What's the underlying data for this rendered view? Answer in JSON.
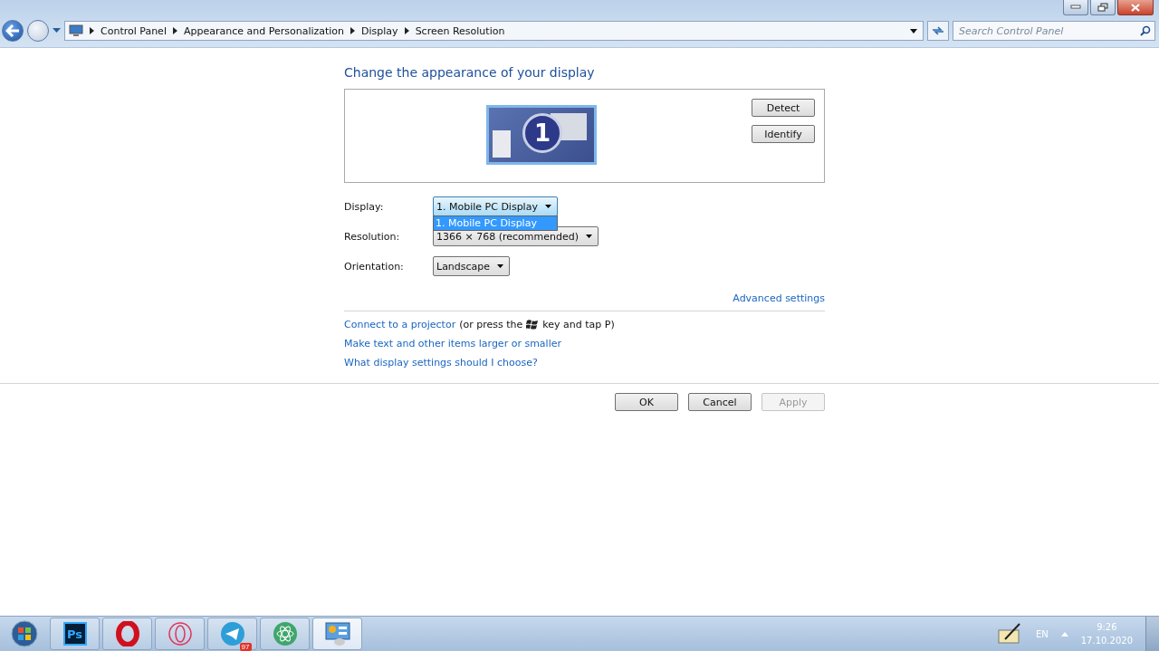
{
  "breadcrumb": [
    "Control Panel",
    "Appearance and Personalization",
    "Display",
    "Screen Resolution"
  ],
  "search": {
    "placeholder": "Search Control Panel"
  },
  "heading": "Change the appearance of your display",
  "monitor": {
    "number": "1"
  },
  "preview_buttons": [
    "Detect",
    "Identify"
  ],
  "fields": [
    {
      "label": "Display:",
      "value": "1. Mobile PC Display",
      "expanded": true,
      "options": [
        {
          "label": "1. Mobile PC Display",
          "selected": true
        }
      ]
    },
    {
      "label": "Resolution:",
      "value": "1366 × 768 (recommended)",
      "expanded": false
    },
    {
      "label": "Orientation:",
      "value": "Landscape",
      "expanded": false
    }
  ],
  "advanced_link": "Advanced settings",
  "projector": {
    "link": "Connect to a projector",
    "before_key": "(or press the",
    "after_key": "key and tap P)"
  },
  "links": [
    "Make text and other items larger or smaller",
    "What display settings should I choose?"
  ],
  "buttons": [
    {
      "label": "OK",
      "disabled": false
    },
    {
      "label": "Cancel",
      "disabled": false
    },
    {
      "label": "Apply",
      "disabled": true
    }
  ],
  "taskbar": [
    {
      "kind": "photoshop",
      "text": "Ps",
      "selected": false
    },
    {
      "kind": "opera",
      "selected": false
    },
    {
      "kind": "opera-gx",
      "selected": false
    },
    {
      "kind": "telegram",
      "badge": "97",
      "selected": false
    },
    {
      "kind": "atom",
      "selected": false
    },
    {
      "kind": "control-panel",
      "selected": true
    }
  ],
  "tray": {
    "language": "EN",
    "time": "9:26",
    "date": "17.10.2020"
  }
}
